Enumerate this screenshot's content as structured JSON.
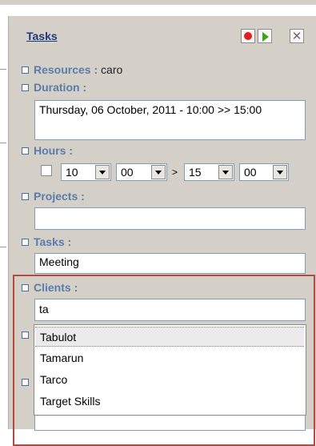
{
  "panel": {
    "title": "Tasks",
    "controls": [
      "record-icon",
      "play-icon",
      "close-icon"
    ]
  },
  "fields": {
    "resources": {
      "label": "Resources :",
      "value": "caro"
    },
    "duration": {
      "label": "Duration :",
      "value": "Thursday, 06 October, 2011 - 10:00 >> 15:00"
    },
    "hours": {
      "label": "Hours :",
      "start_hour": "10",
      "start_minute": "00",
      "separator": ">",
      "end_hour": "15",
      "end_minute": "00"
    },
    "projects": {
      "label": "Projects :",
      "value": ""
    },
    "tasks": {
      "label": "Tasks :",
      "value": "Meeting"
    },
    "clients": {
      "label": "Clients :",
      "value": "ta",
      "suggestions": [
        "Tabulot",
        "Tamarun",
        "Tarco",
        "Target Skills"
      ],
      "highlighted_index": 0
    }
  },
  "colors": {
    "panel_bg": "#d4d0c8",
    "label": "#5b7cab",
    "title": "#1f3a7a",
    "highlight_border": "#b5483f"
  }
}
